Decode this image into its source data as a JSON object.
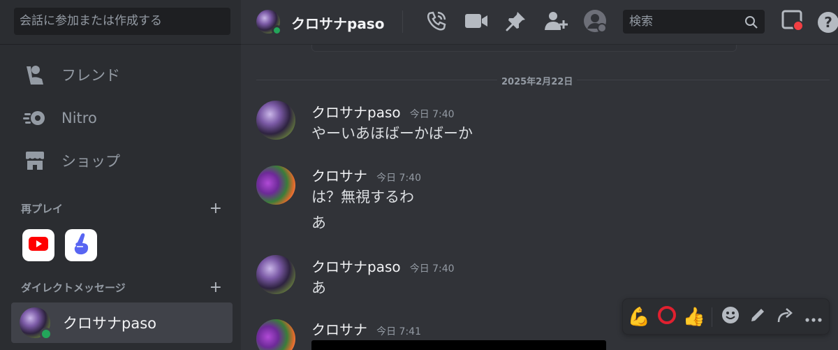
{
  "sidebar": {
    "search_placeholder": "会話に参加または作成する",
    "nav": [
      {
        "label": "フレンド",
        "icon": "friends-icon"
      },
      {
        "label": "Nitro",
        "icon": "nitro-icon"
      },
      {
        "label": "ショップ",
        "icon": "shop-icon"
      }
    ],
    "replay_header": "再プレイ",
    "replay_apps": [
      {
        "name": "youtube",
        "icon": "youtube-icon"
      },
      {
        "name": "app",
        "icon": "hand-icon"
      }
    ],
    "dm_header": "ダイレクトメッセージ",
    "dm_user": "クロサナpaso"
  },
  "header": {
    "user": "クロサナpaso",
    "search_placeholder": "検索",
    "help": "?"
  },
  "chat": {
    "date_divider": "2025年2月22日",
    "messages": [
      {
        "user": "クロサナpaso",
        "time": "今日 7:40",
        "lines": [
          "やーいあほばーかばーか"
        ]
      },
      {
        "user": "クロサナ",
        "time": "今日 7:40",
        "lines": [
          "は？無視するわ",
          "あ"
        ]
      },
      {
        "user": "クロサナpaso",
        "time": "今日 7:40",
        "lines": [
          "あ"
        ]
      },
      {
        "user": "クロサナ",
        "time": "今日 7:41",
        "lines": []
      }
    ]
  },
  "reactions": [
    "💪",
    "⭕",
    "👍"
  ],
  "colors": {
    "accent": "#5865f2",
    "online": "#23a55a",
    "alert": "#f23f43",
    "youtube": "#ff0000"
  }
}
